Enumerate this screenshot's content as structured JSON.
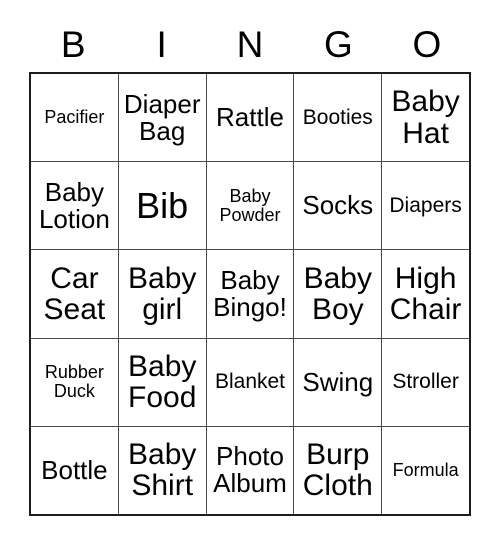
{
  "card": {
    "header_letters": [
      "B",
      "I",
      "N",
      "G",
      "O"
    ],
    "free_space_label": "Baby Bingo!",
    "colors": {
      "background": "#ffffff",
      "text": "#000000",
      "outer_border": "#1c1c1c",
      "grid_line": "#4a4a4a"
    },
    "rows": [
      [
        {
          "label": "Pacifier",
          "size": "xs"
        },
        {
          "label": "Diaper\nBag",
          "size": "md"
        },
        {
          "label": "Rattle",
          "size": "md"
        },
        {
          "label": "Booties",
          "size": "sm"
        },
        {
          "label": "Baby\nHat",
          "size": "lg"
        }
      ],
      [
        {
          "label": "Baby\nLotion",
          "size": "md"
        },
        {
          "label": "Bib",
          "size": "xl"
        },
        {
          "label": "Baby\nPowder",
          "size": "xs"
        },
        {
          "label": "Socks",
          "size": "md"
        },
        {
          "label": "Diapers",
          "size": "sm"
        }
      ],
      [
        {
          "label": "Car\nSeat",
          "size": "lg"
        },
        {
          "label": "Baby\ngirl",
          "size": "lg"
        },
        {
          "label": "Baby\nBingo!",
          "size": "md"
        },
        {
          "label": "Baby\nBoy",
          "size": "lg"
        },
        {
          "label": "High\nChair",
          "size": "lg"
        }
      ],
      [
        {
          "label": "Rubber\nDuck",
          "size": "xs"
        },
        {
          "label": "Baby\nFood",
          "size": "lg"
        },
        {
          "label": "Blanket",
          "size": "sm"
        },
        {
          "label": "Swing",
          "size": "md"
        },
        {
          "label": "Stroller",
          "size": "sm"
        }
      ],
      [
        {
          "label": "Bottle",
          "size": "md"
        },
        {
          "label": "Baby\nShirt",
          "size": "lg"
        },
        {
          "label": "Photo\nAlbum",
          "size": "md"
        },
        {
          "label": "Burp\nCloth",
          "size": "lg"
        },
        {
          "label": "Formula",
          "size": "xs"
        }
      ]
    ]
  }
}
